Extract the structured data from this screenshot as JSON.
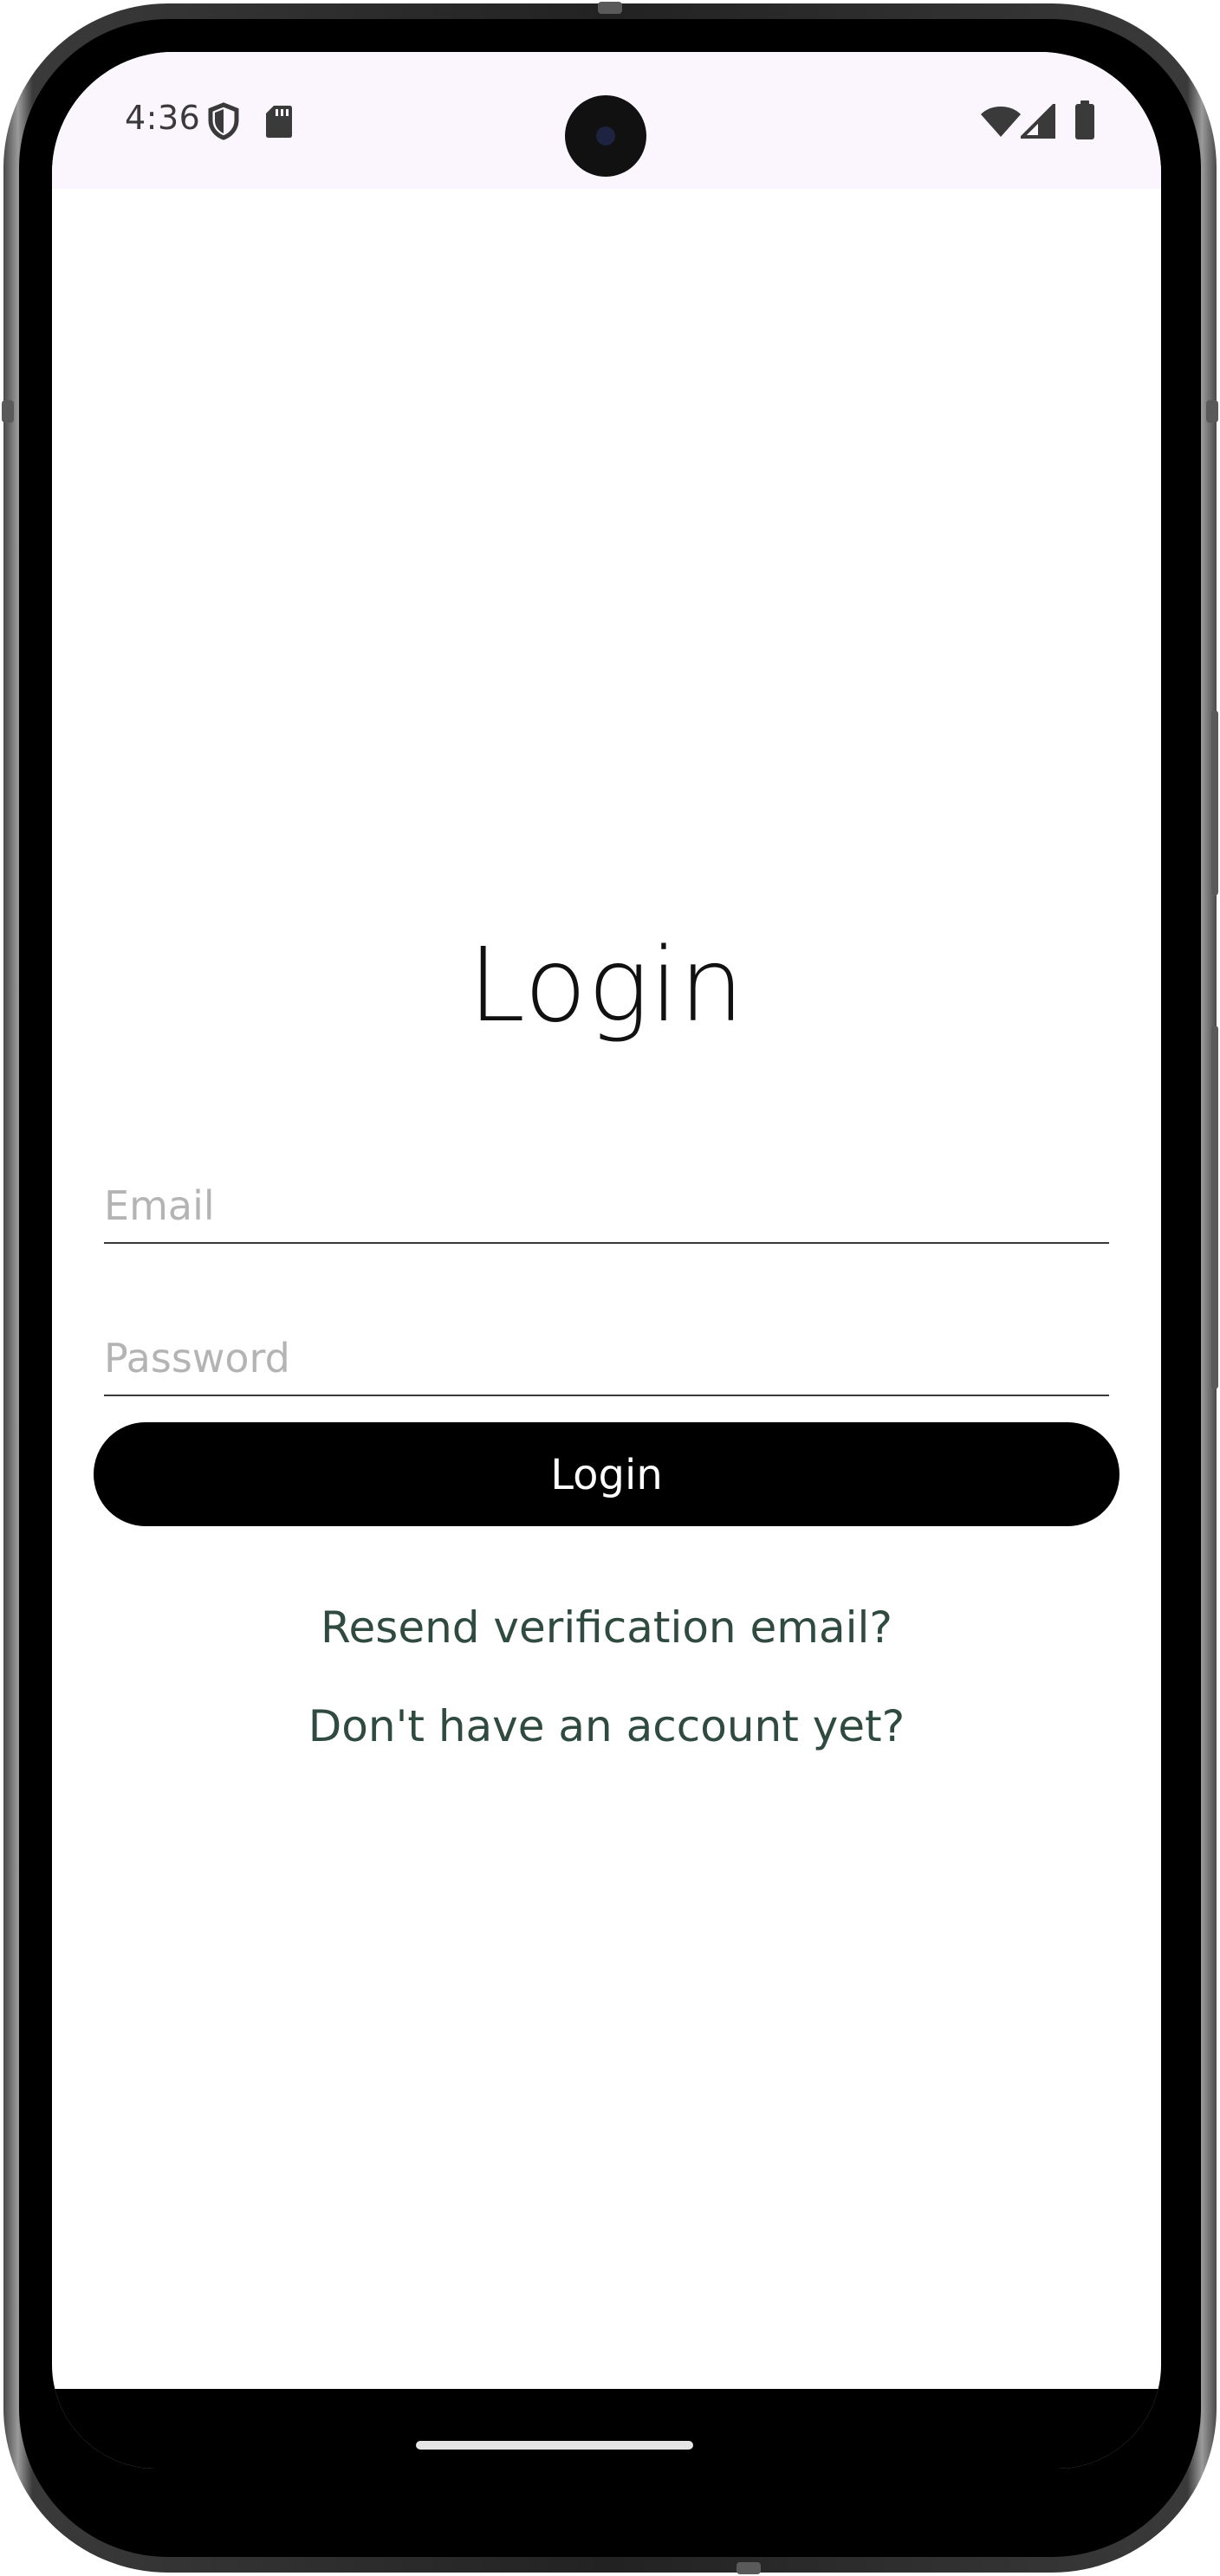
{
  "status_bar": {
    "time": "4:36",
    "left_icons": [
      "shield-icon",
      "sd-card-icon"
    ],
    "right_icons": [
      "wifi-icon",
      "signal-icon",
      "battery-icon"
    ]
  },
  "login": {
    "title": "Login",
    "email": {
      "value": "",
      "placeholder": "Email"
    },
    "password": {
      "value": "",
      "placeholder": "Password"
    },
    "submit_label": "Login",
    "resend_link": "Resend verification email?",
    "signup_link": "Don't have an account yet?"
  },
  "colors": {
    "status_bar_bg": "#fbf6fd",
    "button_bg": "#000000",
    "button_text": "#ffffff",
    "link": "#2f4a3e",
    "placeholder": "#b4b4b4"
  }
}
